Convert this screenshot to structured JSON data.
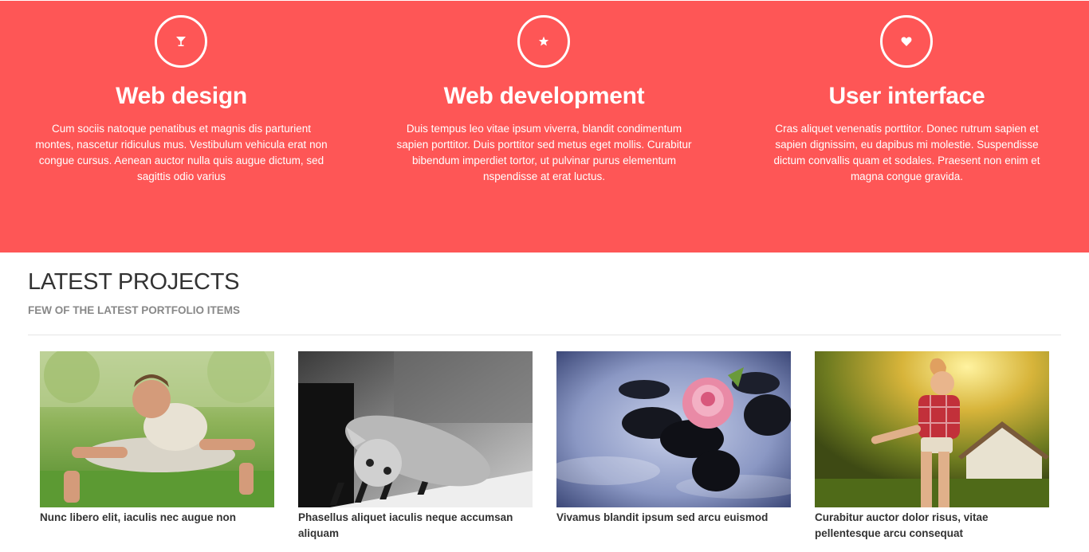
{
  "features": [
    {
      "icon": "cocktail-icon",
      "title": "Web design",
      "text": "Cum sociis natoque penatibus et magnis dis parturient montes, nascetur ridiculus mus. Vestibulum vehicula erat non congue cursus. Aenean auctor nulla quis augue dictum, sed sagittis odio varius"
    },
    {
      "icon": "star-icon",
      "title": "Web development",
      "text": "Duis tempus leo vitae ipsum viverra, blandit condimentum sapien porttitor. Duis porttitor sed metus eget mollis. Curabitur bibendum imperdiet tortor, ut pulvinar purus elementum nspendisse at erat luctus."
    },
    {
      "icon": "heart-icon",
      "title": "User interface",
      "text": "Cras aliquet venenatis porttitor. Donec rutrum sapien et sapien dignissim, eu dapibus mi molestie. Suspendisse dictum convallis quam et sodales. Praesent non enim et magna congue gravida."
    }
  ],
  "projects_section": {
    "title": "LATEST PROJECTS",
    "subtitle": "FEW OF THE LATEST PORTFOLIO ITEMS"
  },
  "projects": [
    {
      "title": "Nunc libero elit, iaculis nec augue non"
    },
    {
      "title": "Phasellus aliquet iaculis neque accumsan aliquam"
    },
    {
      "title": "Vivamus blandit ipsum sed arcu euismod"
    },
    {
      "title": "Curabitur auctor dolor risus, vitae pellentesque arcu consequat"
    }
  ],
  "colors": {
    "accent": "#fe5656"
  }
}
